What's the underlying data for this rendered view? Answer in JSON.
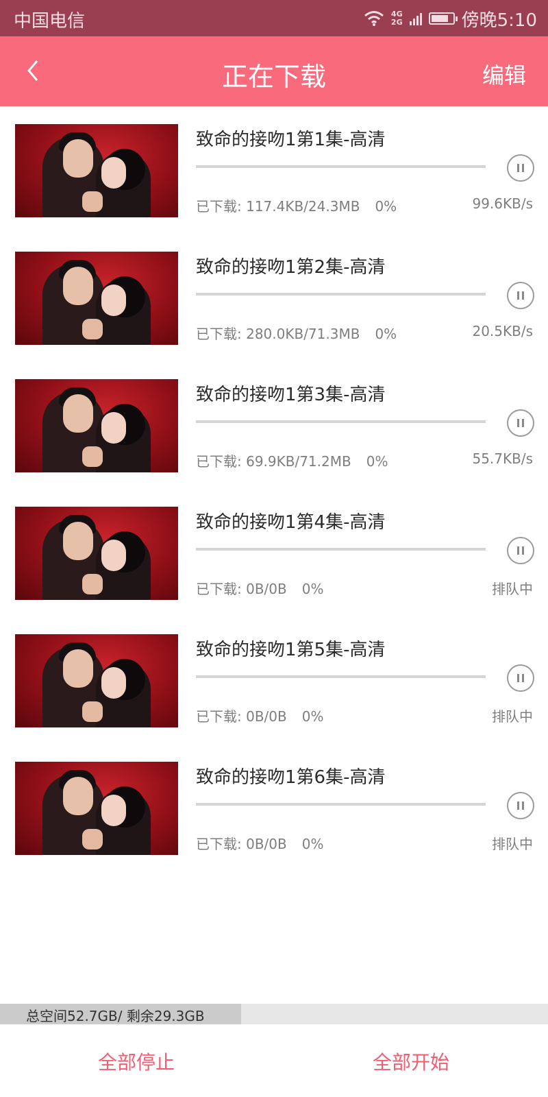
{
  "status_bar": {
    "carrier": "中国电信",
    "network": [
      "4G",
      "2G"
    ],
    "time": "傍晚5:10"
  },
  "app_bar": {
    "title": "正在下载",
    "edit_label": "编辑"
  },
  "downloads": [
    {
      "title": "致命的接吻1第1集-高清",
      "downloaded": "已下载: 117.4KB/24.3MB",
      "percent": "0%",
      "status": "99.6KB/s",
      "progress": 0
    },
    {
      "title": "致命的接吻1第2集-高清",
      "downloaded": "已下载: 280.0KB/71.3MB",
      "percent": "0%",
      "status": "20.5KB/s",
      "progress": 0
    },
    {
      "title": "致命的接吻1第3集-高清",
      "downloaded": "已下载: 69.9KB/71.2MB",
      "percent": "0%",
      "status": "55.7KB/s",
      "progress": 0
    },
    {
      "title": "致命的接吻1第4集-高清",
      "downloaded": "已下载: 0B/0B",
      "percent": "0%",
      "status": "排队中",
      "progress": 0
    },
    {
      "title": "致命的接吻1第5集-高清",
      "downloaded": "已下载: 0B/0B",
      "percent": "0%",
      "status": "排队中",
      "progress": 0
    },
    {
      "title": "致命的接吻1第6集-高清",
      "downloaded": "已下载: 0B/0B",
      "percent": "0%",
      "status": "排队中",
      "progress": 0
    }
  ],
  "storage": {
    "label": "总空间52.7GB/ 剩余29.3GB",
    "used_fraction": 0.44
  },
  "footer": {
    "stop_all": "全部停止",
    "start_all": "全部开始"
  },
  "colors": {
    "status_bar": "#9a3e51",
    "app_bar": "#f96b7c",
    "accent_text": "#f25d72"
  },
  "icons": {
    "back": "chevron-left-icon",
    "pause": "pause-circle-icon",
    "wifi": "wifi-icon",
    "signal": "signal-bars-icon",
    "battery": "battery-charging-icon"
  }
}
